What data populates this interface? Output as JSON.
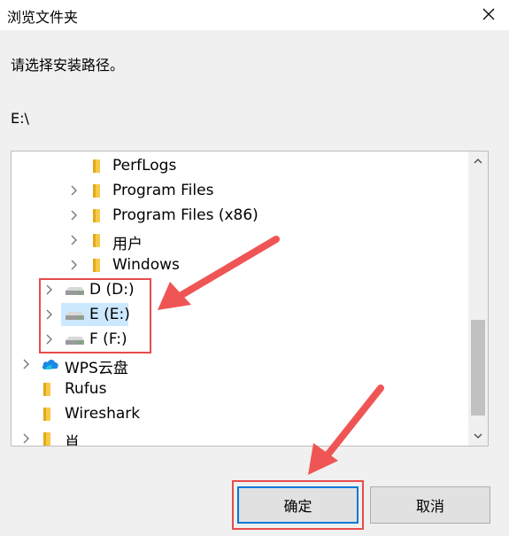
{
  "window": {
    "title": "浏览文件夹"
  },
  "dialog": {
    "prompt": "请选择安装路径。",
    "current_path": "E:\\"
  },
  "tree": {
    "items": [
      {
        "label": "PerfLogs",
        "icon": "folder-icon",
        "expandable": false
      },
      {
        "label": "Program Files",
        "icon": "folder-icon",
        "expandable": true
      },
      {
        "label": "Program Files (x86)",
        "icon": "folder-icon",
        "expandable": true
      },
      {
        "label": "用户",
        "icon": "folder-icon",
        "expandable": true
      },
      {
        "label": "Windows",
        "icon": "folder-icon",
        "expandable": true
      },
      {
        "label": "D (D:)",
        "icon": "drive-icon",
        "expandable": true
      },
      {
        "label": "E (E:)",
        "icon": "drive-icon",
        "expandable": true,
        "selected": true
      },
      {
        "label": "F (F:)",
        "icon": "drive-icon",
        "expandable": true
      },
      {
        "label": "WPS云盘",
        "icon": "cloud-icon",
        "expandable": true
      },
      {
        "label": "Rufus",
        "icon": "folder-icon",
        "expandable": false
      },
      {
        "label": "Wireshark",
        "icon": "folder-icon",
        "expandable": false
      },
      {
        "label": "肖",
        "icon": "folder-icon",
        "expandable": true
      }
    ]
  },
  "buttons": {
    "ok": "确定",
    "cancel": "取消"
  },
  "colors": {
    "selection": "#cce8ff",
    "folder": "#f7c948",
    "highlight": "#e74c4c",
    "accent": "#0078d7"
  }
}
